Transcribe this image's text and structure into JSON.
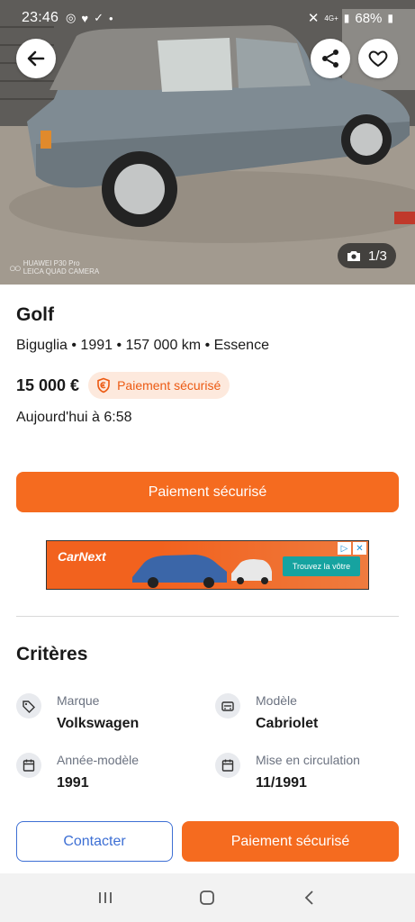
{
  "status_bar": {
    "time": "23:46",
    "battery": "68%",
    "network": "4G+"
  },
  "hero": {
    "photo_counter": "1/3",
    "watermark_line1": "HUAWEI P30 Pro",
    "watermark_line2": "LEICA QUAD CAMERA"
  },
  "listing": {
    "title": "Golf",
    "meta": "Biguglia • 1991 • 157 000 km • Essence",
    "price": "15 000 €",
    "secure_badge": "Paiement sécurisé",
    "date": "Aujourd'hui à 6:58",
    "cta_label": "Paiement sécurisé"
  },
  "ad": {
    "brand": "CarNext",
    "button": "Trouvez la vôtre"
  },
  "criteria": {
    "title": "Critères",
    "items": [
      {
        "label": "Marque",
        "value": "Volkswagen",
        "icon": "tag-icon"
      },
      {
        "label": "Modèle",
        "value": "Cabriolet",
        "icon": "car-model-icon"
      },
      {
        "label": "Année-modèle",
        "value": "1991",
        "icon": "calendar-icon"
      },
      {
        "label": "Mise en circulation",
        "value": "11/1991",
        "icon": "calendar-icon"
      }
    ]
  },
  "actions": {
    "contact": "Contacter",
    "pay": "Paiement sécurisé"
  },
  "colors": {
    "accent": "#f56b1f",
    "link_blue": "#3d6fd4",
    "badge_bg": "#fde9dd"
  }
}
